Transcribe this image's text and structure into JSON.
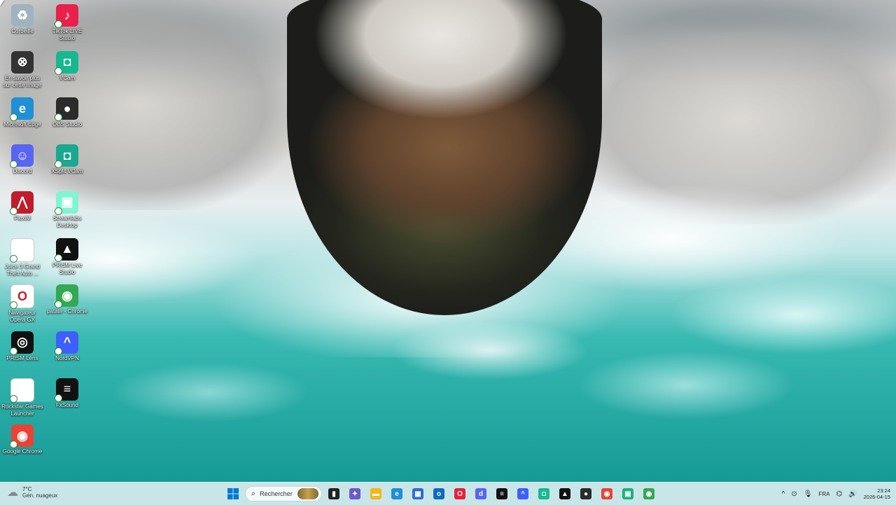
{
  "desktop": {
    "icons_col1": [
      {
        "label": "Corbeille",
        "icon": "recycle-bin-icon",
        "color": "#9fb3c0"
      },
      {
        "label": "En savoir plus sur cette image",
        "icon": "camera-info-icon",
        "color": "#333333"
      },
      {
        "label": "Microsoft Edge",
        "icon": "edge-icon",
        "color": "#1f8fd6"
      },
      {
        "label": "Discord",
        "icon": "discord-icon",
        "color": "#5865f2"
      },
      {
        "label": "FlexiM",
        "icon": "flexim-icon",
        "color": "#c01c2c"
      },
      {
        "label": "Juice 3 Grand Theft Auto ...",
        "icon": "file-icon",
        "color": "#ffffff"
      },
      {
        "label": "Navigateur Opera GX",
        "icon": "opera-gx-icon",
        "color": "#ffffff"
      },
      {
        "label": "PRISM Lens",
        "icon": "prism-lens-icon",
        "color": "#111111"
      },
      {
        "label": "Rockstar Games Launcher",
        "icon": "file-icon",
        "color": "#ffffff"
      },
      {
        "label": "Google Chrome",
        "icon": "chrome-icon",
        "color": "#ea4335"
      }
    ],
    "icons_col2": [
      {
        "label": "TikTok LIVE Studio",
        "icon": "tiktok-live-icon",
        "color": "#e8204a"
      },
      {
        "label": "VCam",
        "icon": "vcam-icon",
        "color": "#17b890"
      },
      {
        "label": "OBS Studio",
        "icon": "obs-icon",
        "color": "#2b2b2b"
      },
      {
        "label": "XSplit VCam",
        "icon": "xsplit-vcam-icon",
        "color": "#1aa891"
      },
      {
        "label": "Streamlabs Desktop",
        "icon": "streamlabs-icon",
        "color": "#80f5d2"
      },
      {
        "label": "PRISM Live Studio",
        "icon": "prism-live-icon",
        "color": "#111111"
      },
      {
        "label": "patate - Chrome",
        "icon": "chrome-profile-icon",
        "color": "#34a853"
      },
      {
        "label": "NordVPN",
        "icon": "nordvpn-icon",
        "color": "#3e5fff"
      },
      {
        "label": "FxSound",
        "icon": "fxsound-icon",
        "color": "#111111"
      }
    ]
  },
  "taskbar": {
    "weather": {
      "temp": "7°C",
      "desc": "Gén. nuageux"
    },
    "search_placeholder": "Rechercher",
    "apps": [
      {
        "icon": "file-explorer-black-icon",
        "color": "#222222",
        "glyph": "▮"
      },
      {
        "icon": "copilot-icon",
        "color": "#6a5acd",
        "glyph": "✦"
      },
      {
        "icon": "folder-icon",
        "color": "#f2b81c",
        "glyph": "▬"
      },
      {
        "icon": "edge-icon",
        "color": "#1f8fd6",
        "glyph": "e"
      },
      {
        "icon": "store-icon",
        "color": "#2b6cd6",
        "glyph": "▦"
      },
      {
        "icon": "outlook-icon",
        "color": "#0f6cbd",
        "glyph": "o"
      },
      {
        "icon": "opera-gx-icon",
        "color": "#e8203a",
        "glyph": "O"
      },
      {
        "icon": "discord-icon",
        "color": "#5865f2",
        "glyph": "d"
      },
      {
        "icon": "fxsound-icon",
        "color": "#111111",
        "glyph": "≡"
      },
      {
        "icon": "nordvpn-icon",
        "color": "#3e5fff",
        "glyph": "^"
      },
      {
        "icon": "vcam-icon",
        "color": "#17b890",
        "glyph": "◘"
      },
      {
        "icon": "prism-live-icon",
        "color": "#111111",
        "glyph": "▲"
      },
      {
        "icon": "obs-icon",
        "color": "#2b2b2b",
        "glyph": "●"
      },
      {
        "icon": "chrome-icon",
        "color": "#ea4335",
        "glyph": "◉"
      },
      {
        "icon": "streamlabs-icon",
        "color": "#19b27b",
        "glyph": "▣"
      },
      {
        "icon": "chrome-profile-icon",
        "color": "#34a853",
        "glyph": "◉"
      }
    ],
    "tray": {
      "chevron": "^",
      "language": "FRA",
      "time": "23:24",
      "date": "2026-04-15"
    }
  },
  "colors": {
    "taskbar_bg": "#d7ecee",
    "accent": "#0078d4"
  }
}
